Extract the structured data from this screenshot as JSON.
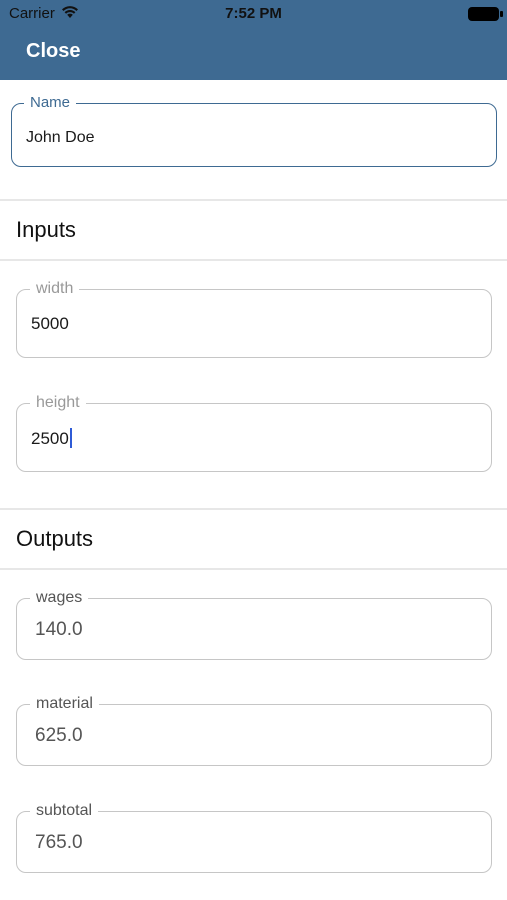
{
  "status_bar": {
    "carrier": "Carrier",
    "time": "7:52 PM"
  },
  "header": {
    "close_label": "Close",
    "background": "#3e6a92"
  },
  "name_field": {
    "label": "Name",
    "value": "John Doe"
  },
  "inputs": {
    "title": "Inputs",
    "fields": [
      {
        "label": "width",
        "value": "5000"
      },
      {
        "label": "height",
        "value": "2500"
      }
    ]
  },
  "outputs": {
    "title": "Outputs",
    "fields": [
      {
        "label": "wages",
        "value": "140.0"
      },
      {
        "label": "material",
        "value": "625.0"
      },
      {
        "label": "subtotal",
        "value": "765.0"
      }
    ]
  },
  "colors": {
    "accent": "#3e6a92",
    "cursor": "#2f5bd6"
  }
}
